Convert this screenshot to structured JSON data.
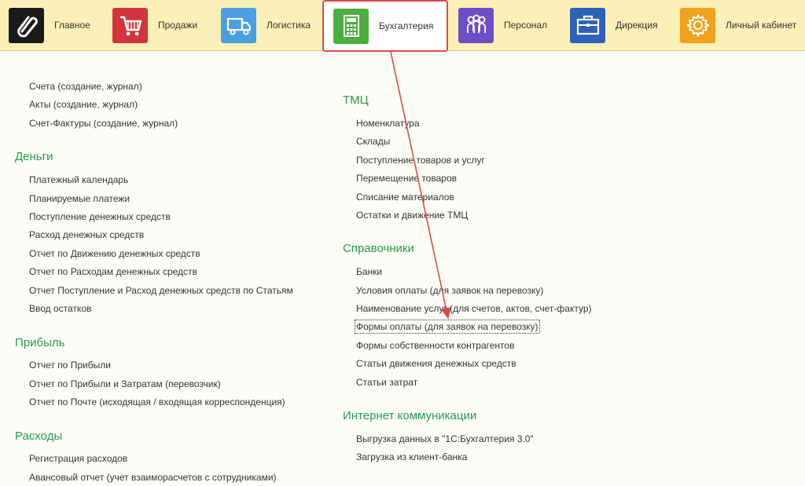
{
  "nav": {
    "items": [
      {
        "label": "Главное",
        "icon": "paperclip-icon",
        "color": "#1a1a1a"
      },
      {
        "label": "Продажи",
        "icon": "shopping-cart-icon",
        "color": "#d2353e"
      },
      {
        "label": "Логистика",
        "icon": "truck-icon",
        "color": "#4a9fe0"
      },
      {
        "label": "Бухгалтерия",
        "icon": "calculator-icon",
        "color": "#4caf3d",
        "active": true
      },
      {
        "label": "Персонал",
        "icon": "people-icon",
        "color": "#6d4fc4"
      },
      {
        "label": "Дирекция",
        "icon": "briefcase-icon",
        "color": "#2d63b8"
      },
      {
        "label": "Личный кабинет",
        "icon": "gear-icon",
        "color": "#f1a21d"
      }
    ]
  },
  "left": {
    "top_links": [
      "Счета (создание, журнал)",
      "Акты (создание, журнал)",
      "Счет-Фактуры (создание, журнал)"
    ],
    "money": {
      "title": "Деньги",
      "links": [
        "Платежный календарь",
        "Планируемые платежи",
        "Поступление денежных средств",
        "Расход денежных средств",
        "Отчет по Движению денежных средств",
        "Отчет по Расходам денежных средств",
        "Отчет Поступление и Расход денежных средств по Статьям",
        "Ввод остатков"
      ]
    },
    "profit": {
      "title": "Прибыль",
      "links": [
        "Отчет по Прибыли",
        "Отчет по Прибыли и Затратам (перевозчик)",
        "Отчет по Почте (исходящая / входящая корреспонденция)"
      ]
    },
    "expenses": {
      "title": "Расходы",
      "links": [
        "Регистрация расходов",
        "Авансовый отчет (учет взаиморасчетов с сотрудниками)"
      ]
    }
  },
  "right": {
    "tmc": {
      "title": "ТМЦ",
      "links": [
        "Номенклатура",
        "Склады",
        "Поступление товаров и услуг",
        "Перемещение товаров",
        "Списание материалов",
        "Остатки и движение ТМЦ"
      ]
    },
    "refs": {
      "title": "Справочники",
      "links": [
        "Банки",
        "Условия оплаты (для заявок на перевозку)",
        "Наименование услуг (для счетов, актов, счет-фактур)",
        "Формы оплаты (для заявок на перевозку)",
        "Формы собственности контрагентов",
        "Статьи движения денежных средств",
        "Статьи затрат"
      ]
    },
    "internet": {
      "title": "Интернет коммуникации",
      "links": [
        "Выгрузка данных в \"1С:Бухгалтерия 3.0\"",
        "Загрузка из клиент-банка"
      ]
    }
  },
  "annotation": {
    "color": "#e0484a"
  }
}
